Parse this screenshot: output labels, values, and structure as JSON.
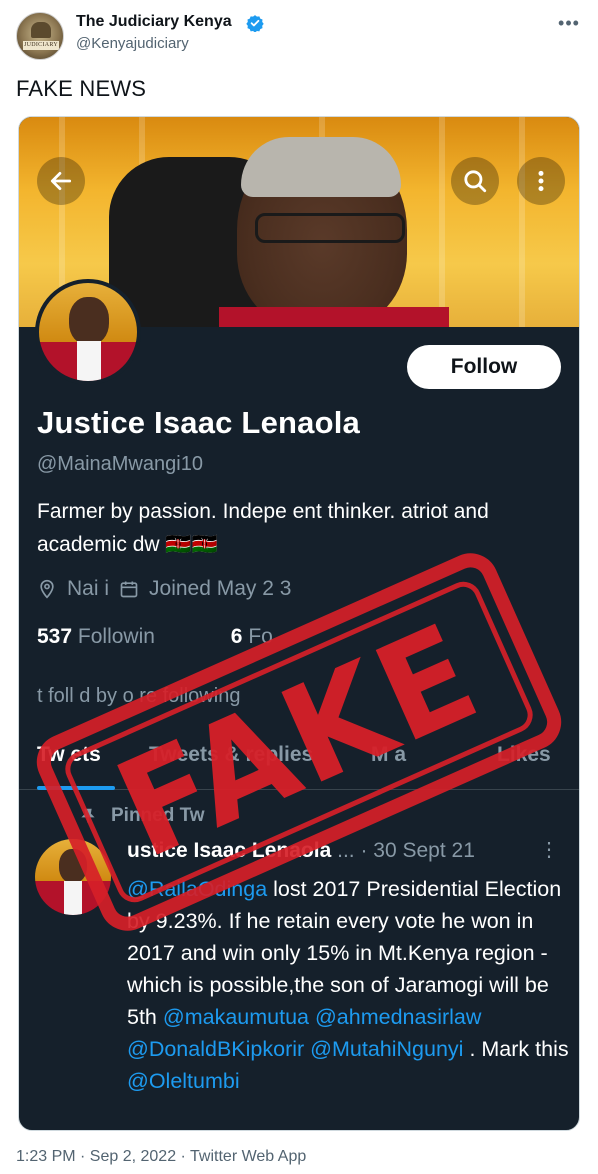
{
  "tweet": {
    "author_name": "The Judiciary Kenya",
    "author_handle": "@Kenyajudiciary",
    "avatar_text": "JUDICIARY",
    "text": "FAKE NEWS",
    "timestamp": "1:23 PM · Sep 2, 2022 · Twitter Web App",
    "verified": true
  },
  "embedded_profile": {
    "follow_label": "Follow",
    "name": "Justice Isaac Lenaola",
    "handle": "@MainaMwangi10",
    "bio": "Farmer by passion. Indepe   ent thinker.  atriot and academic dw   🇰🇪🇰🇪",
    "location": "Nai   i",
    "joined": "Joined May 2  3",
    "following_count": "537",
    "following_label": "Followin",
    "followers_count": "6",
    "followers_label": "Fo",
    "followed_by": "t foll   d by        o     re following",
    "tabs": [
      "Tw  ets",
      "Tweets & replies",
      "M   a",
      "Likes"
    ],
    "pinned_label": "Pinned Tw",
    "stamp_text": "FAKE"
  },
  "pinned_post": {
    "name": "ustice Isaac Lenaola",
    "meta": " ... · 30 Sept 21",
    "more": "⋮",
    "mention_1": "@RailaOdinga",
    "text_1": " lost 2017 Presidential Election by 9.23%. If he retain every vote he won in 2017 and win only 15% in Mt.Kenya region - which is possible,the son of Jaramogi will be 5th ",
    "mention_2": "@makaumutua",
    "mention_3": "@ahmednasirlaw",
    "mention_4": "@DonaldBKipkorir",
    "mention_5": "@MutahiNgunyi",
    "text_2": " . Mark this ",
    "mention_6": "@Oleltumbi"
  },
  "colors": {
    "verified_blue": "#1d9bf0",
    "dark_bg": "#15202b",
    "stamp_red": "#d62028"
  },
  "icons": [
    "verified-badge-icon",
    "more-icon",
    "back-arrow-icon",
    "search-icon",
    "kebab-menu-icon",
    "location-icon",
    "calendar-icon",
    "pin-icon"
  ]
}
